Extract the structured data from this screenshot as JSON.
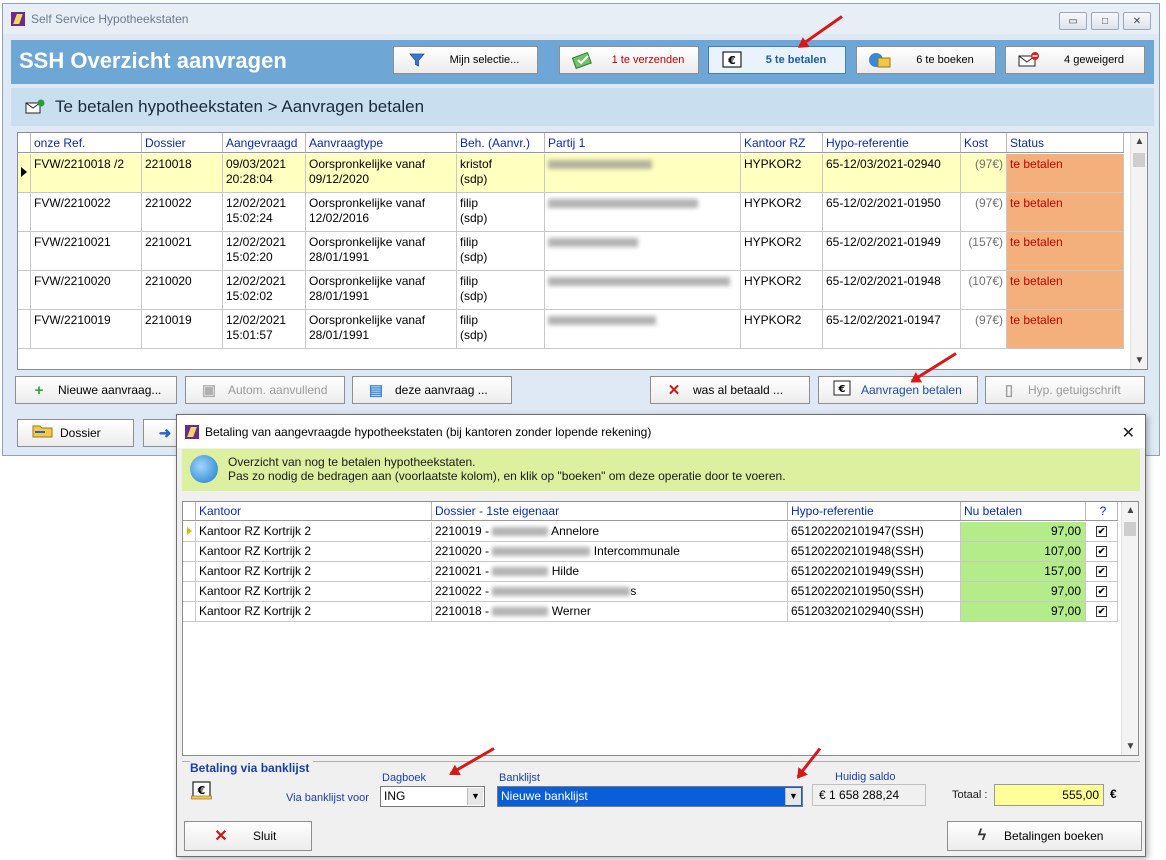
{
  "main": {
    "window_title": "Self Service Hypotheekstaten",
    "app_title": "SSH  Overzicht aanvragen",
    "header_buttons": [
      {
        "label": "Mijn selectie...",
        "icon": "filter-icon"
      },
      {
        "label": "1 te verzenden",
        "icon": "send-icon"
      },
      {
        "label": "5 te betalen",
        "icon": "euro-icon"
      },
      {
        "label": "6 te boeken",
        "icon": "book-icon"
      },
      {
        "label": "4 geweigerd",
        "icon": "rejected-mail-icon"
      }
    ],
    "subheader": "Te betalen hypotheekstaten > Aanvragen betalen",
    "grid": {
      "columns": [
        "onze Ref.",
        "Dossier",
        "Aangevraagd",
        "Aanvraagtype",
        "Beh. (Aanvr.)",
        "Partij 1",
        "Kantoor RZ",
        "Hypo-referentie",
        "Kost",
        "Status"
      ],
      "rows": [
        {
          "ref": "FVW/2210018 /2",
          "dossier": "2210018",
          "date": "09/03/2021",
          "time": "20:28:04",
          "type1": "Oorspronkelijke vanaf",
          "type2": "09/12/2020",
          "beh1": "kristof",
          "beh2": "(sdp)",
          "kantoor": "HYPKOR2",
          "hypo": "65-12/03/2021-02940",
          "kost": "(97€)",
          "status": "te betalen"
        },
        {
          "ref": "FVW/2210022",
          "dossier": "2210022",
          "date": "12/02/2021",
          "time": "15:02:24",
          "type1": "Oorspronkelijke vanaf",
          "type2": "12/02/2016",
          "beh1": "filip",
          "beh2": "(sdp)",
          "kantoor": "HYPKOR2",
          "hypo": "65-12/02/2021-01950",
          "kost": "(97€)",
          "status": "te betalen"
        },
        {
          "ref": "FVW/2210021",
          "dossier": "2210021",
          "date": "12/02/2021",
          "time": "15:02:20",
          "type1": "Oorspronkelijke vanaf",
          "type2": "28/01/1991",
          "beh1": "filip",
          "beh2": "(sdp)",
          "kantoor": "HYPKOR2",
          "hypo": "65-12/02/2021-01949",
          "kost": "(157€)",
          "status": "te betalen"
        },
        {
          "ref": "FVW/2210020",
          "dossier": "2210020",
          "date": "12/02/2021",
          "time": "15:02:02",
          "type1": "Oorspronkelijke vanaf",
          "type2": "28/01/1991",
          "beh1": "filip",
          "beh2": "(sdp)",
          "kantoor": "HYPKOR2",
          "hypo": "65-12/02/2021-01948",
          "kost": "(107€)",
          "status": "te betalen"
        },
        {
          "ref": "FVW/2210019",
          "dossier": "2210019",
          "date": "12/02/2021",
          "time": "15:01:57",
          "type1": "Oorspronkelijke vanaf",
          "type2": "28/01/1991",
          "beh1": "filip",
          "beh2": "(sdp)",
          "kantoor": "HYPKOR2",
          "hypo": "65-12/02/2021-01947",
          "kost": "(97€)",
          "status": "te betalen"
        }
      ]
    },
    "buttons": {
      "new": "Nieuwe aanvraag...",
      "auto": "Autom. aanvullend",
      "this": "deze aanvraag ...",
      "paid": "was al betaald ...",
      "pay": "Aanvragen betalen",
      "cert": "Hyp. getuigschrift",
      "dossier": "Dossier"
    }
  },
  "dialog": {
    "title": "Betaling van aangevraagde hypotheekstaten (bij kantoren zonder lopende rekening)",
    "info_line1": "Overzicht van nog te betalen hypotheekstaten.",
    "info_line2": "Pas zo nodig de bedragen aan (voorlaatste kolom), en klik op \"boeken\" om deze operatie door te voeren.",
    "grid": {
      "columns": [
        "Kantoor",
        "Dossier - 1ste eigenaar",
        "Hypo-referentie",
        "Nu betalen",
        "?"
      ],
      "rows": [
        {
          "kantoor": "Kantoor RZ Kortrijk 2",
          "dossier": "2210019 -",
          "owner": "Annelore",
          "hypo": "651202202101947(SSH)",
          "amount": "97,00",
          "checked": "✔"
        },
        {
          "kantoor": "Kantoor RZ Kortrijk 2",
          "dossier": "2210020 -",
          "owner": "Intercommunale",
          "hypo": "651202202101948(SSH)",
          "amount": "107,00",
          "checked": "✔"
        },
        {
          "kantoor": "Kantoor RZ Kortrijk 2",
          "dossier": "2210021 -",
          "owner": "Hilde",
          "hypo": "651202202101949(SSH)",
          "amount": "157,00",
          "checked": "✔"
        },
        {
          "kantoor": "Kantoor RZ Kortrijk 2",
          "dossier": "2210022 -",
          "owner": "s",
          "hypo": "651202202101950(SSH)",
          "amount": "97,00",
          "checked": "✔"
        },
        {
          "kantoor": "Kantoor RZ Kortrijk 2",
          "dossier": "2210018 -",
          "owner": "Werner",
          "hypo": "651203202102940(SSH)",
          "amount": "97,00",
          "checked": "✔"
        }
      ]
    },
    "payment": {
      "legend": "Betaling via banklijst",
      "via_label": "Via banklijst voor",
      "dagboek_label": "Dagboek",
      "dagboek_value": "ING",
      "banklijst_label": "Banklijst",
      "banklijst_value": "Nieuwe banklijst",
      "saldo_label": "Huidig saldo",
      "saldo_value": "€ 1 658 288,24",
      "total_label": "Totaal :",
      "total_value": "555,00",
      "currency": "€"
    },
    "buttons": {
      "close": "Sluit",
      "book": "Betalingen boeken"
    }
  },
  "colors": {
    "header_band": "#6ea6d6",
    "status_bg": "#f4b07c",
    "amount_bg": "#b4ec8a",
    "info_bg": "#dcf0a0",
    "arrow": "#d81818"
  }
}
